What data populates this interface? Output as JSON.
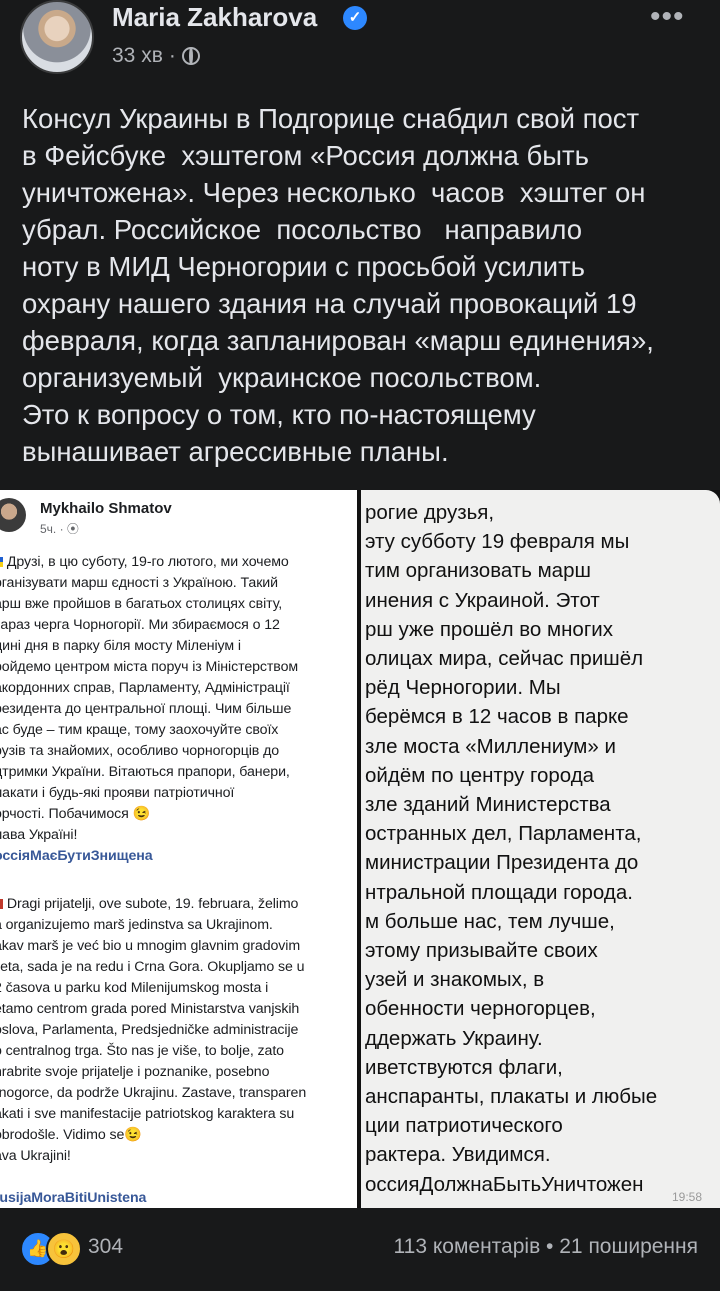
{
  "post": {
    "author": "Maria Zakharova",
    "time": "33 хв",
    "more": "•••",
    "text": "Консул Украины в Подгорице снабдил свой пост\nв Фейсбуке  хэштегом «Россия должна быть\nуничтожена». Через несколько  часов  хэштег он\nубрал. Российское  посольство   направило\nноту в МИД Черногории с просьбой усилить\nохрану нашего здания на случай провокаций 19\nфевраля, когда запланирован «марш единения»,\nорганизуемый  украинское посольством.\nЭто к вопросу о том, кто по-настоящему\nвынашивает агрессивные планы."
  },
  "screenshot_left": {
    "author": "Mykhailo Shmatov",
    "time": "5ч.",
    "ua_lines": [
      "Друзі, в цю суботу, 19-го лютого, ми хочемо",
      "рганізувати марш єдності з Україною. Такий",
      "арш вже пройшов в багатьох столицях світу,",
      "зараз черга Чорногорії. Ми збираємося о 12",
      "дині дня в парку біля мосту Міленіум і",
      "ройдемо центром міста поруч із Міністерством",
      "акордонних справ, Парламенту, Адміністрації",
      "резидента до центральної площі. Чим більше",
      "ас буде – тим краще, тому заохочуйте своїх",
      "рузів та знайомих, особливо чорногорців до",
      "дтримки України. Вітаються прапори, банери,",
      "лакати і будь-які прояви патріотичної",
      "орчості. Побачимося 😉",
      "лава Україні!"
    ],
    "ua_tag": "оссіяМаєБутиЗнищена",
    "me_lines": [
      "Dragi prijatelji, ove subote, 19. februara, želimo",
      "a organizujemo marš jedinstva sa Ukrajinom.",
      "akav marš je već bio u mnogim glavnim gradovim",
      "ijeta, sada je na redu i Crna Gora. Okupljamo se u",
      "2 časova u parku kod Milenijumskog mosta i",
      "etamo centrom grada pored Ministarstva vanjskih",
      "oslova, Parlamenta, Predsjedničke administracije",
      "o centralnog trga. Što nas je više, to bolje, zato",
      "hrabrite svoje prijatelje i poznanike, posebno",
      "rnogorce, da podrže Ukrajinu. Zastave, transparen",
      "akati i sve manifestacije patriotskog karaktera su",
      "obrodošle. Vidimo se😉",
      "ava Ukrajini!"
    ],
    "me_tag": "rusijaMoraBitiUnistena"
  },
  "screenshot_right": {
    "text": "рогие друзья,\nэту субботу 19 февраля мы\nтим организовать марш\nинения с Украиной. Этот\nрш уже прошёл во многих\nолицах мира, сейчас пришёл\nрёд Черногории. Мы\nберёмся в 12 часов в парке\nзле моста «Миллениум» и\nойдём по центру города\nзле зданий Министерства\nостранных дел, Парламента,\nминистрации Президента до\nнтральной площади города.\nм больше нас, тем лучше,\nэтому призывайте своих\nузей и знакомых, в\nобенности черногорцев,\nддержать Украину.\nиветствуются флаги,\nанспаранты, плакаты и любые\nции патриотического\nрактера. Увидимся.\nоссияДолжнаБытьУничтожен",
    "time": "19:58"
  },
  "footer": {
    "reaction_count": "304",
    "comments_shares": "113 коментарів • 21 поширення"
  },
  "colors": {
    "background": "#18191a",
    "text": "#e4e6eb",
    "secondary": "#b0b3b8",
    "accent": "#2d88ff"
  }
}
